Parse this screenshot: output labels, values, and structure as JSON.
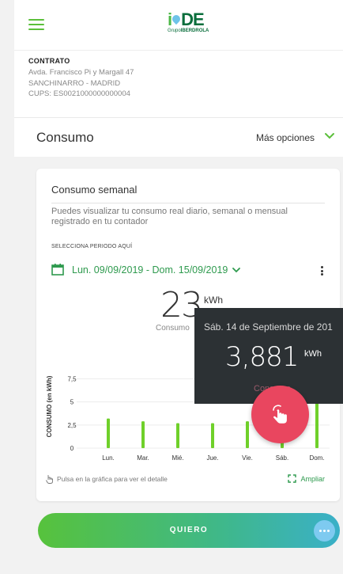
{
  "header": {
    "menu_icon": "hamburger-icon",
    "logo_text_green": "i",
    "logo_text_dark": "DE",
    "logo_sub_prefix": "Grupo",
    "logo_sub_brand": "IBERDROLA"
  },
  "contract": {
    "title": "CONTRATO",
    "address1": "Avda. Francisco Pi y Margall 47",
    "address2": "SANCHINARRO - MADRID",
    "cups": "CUPS: ES0021000000000004"
  },
  "section": {
    "title": "Consumo",
    "options_label": "Más opciones"
  },
  "card": {
    "title": "Consumo semanal",
    "description": "Puedes visualizar tu consumo real diario, semanal o mensual registrado en tu contador",
    "period_label": "SELECCIONA PERIODO AQUÍ",
    "period_value": "Lun. 09/09/2019 - Dom. 15/09/2019",
    "total_value": "23",
    "total_unit": "kWh",
    "total_label": "Consumo",
    "hint": "Pulsa en la gráfica para ver el detalle",
    "expand_label": "Ampliar"
  },
  "tooltip": {
    "date": "Sáb. 14 de Septiembre de 201",
    "value": "3,881",
    "unit": "kWh",
    "label": "Consumo"
  },
  "cta": {
    "label": "QUIERO"
  },
  "colors": {
    "accent_green": "#5bbf3a",
    "link_green": "#2e9a4e",
    "bar_green": "#6fd02a",
    "tooltip_bg": "#2c3134",
    "touch_red": "#e9465f"
  },
  "chart_data": {
    "type": "bar",
    "ylabel": "CONSUMO (en kWh)",
    "categories": [
      "Lun.",
      "Mar.",
      "Mié.",
      "Jue.",
      "Vie.",
      "Sáb.",
      "Dom."
    ],
    "values": [
      3.2,
      2.9,
      2.7,
      2.7,
      2.9,
      3.881,
      8.0
    ],
    "yticks": [
      "0",
      "2,5",
      "5",
      "7,5"
    ],
    "ytick_values": [
      0,
      2.5,
      5,
      7.5
    ],
    "ylim": [
      0,
      9
    ],
    "grid": true
  }
}
